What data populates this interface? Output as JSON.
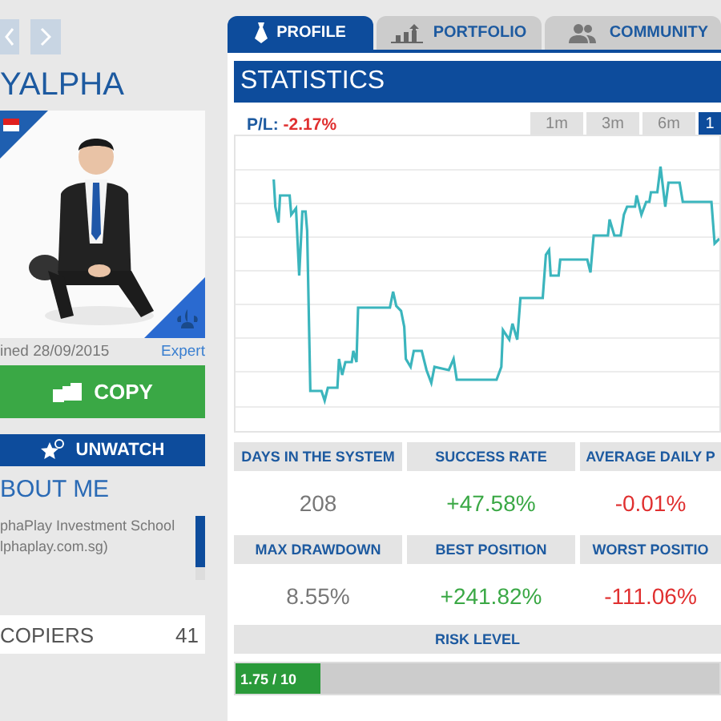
{
  "profile": {
    "name": "YALPHA",
    "joined": "ined 28/09/2015",
    "rank": "Expert",
    "copy_button": "COPY",
    "watch_button": "UNWATCH",
    "about_title": "BOUT ME",
    "about_lines": [
      "phaPlay Investment School",
      "lphaplay.com.sg)"
    ],
    "copiers_label": "COPIERS",
    "copiers_count": "41"
  },
  "tabs": [
    {
      "label": "PROFILE",
      "kind": "tie",
      "selected": true
    },
    {
      "label": "PORTFOLIO",
      "kind": "bars",
      "selected": false
    },
    {
      "label": "COMMUNITY",
      "kind": "people",
      "selected": false
    }
  ],
  "statistics": {
    "title": "STATISTICS",
    "pl_label": "P/L:",
    "pl_value": "-2.17%",
    "ranges": [
      {
        "label": "1m",
        "selected": false
      },
      {
        "label": "3m",
        "selected": false
      },
      {
        "label": "6m",
        "selected": false
      },
      {
        "label": "1",
        "selected": true
      }
    ],
    "stats": [
      {
        "label": "DAYS IN THE SYSTEM",
        "value": "208",
        "kind": "neutral"
      },
      {
        "label": "SUCCESS RATE",
        "value": "+47.58%",
        "kind": "positive"
      },
      {
        "label": "AVERAGE DAILY P",
        "value": "-0.01%",
        "kind": "negative"
      },
      {
        "label": "MAX DRAWDOWN",
        "value": "8.55%",
        "kind": "neutral"
      },
      {
        "label": "BEST POSITION",
        "value": "+241.82%",
        "kind": "positive"
      },
      {
        "label": "WORST POSITIO",
        "value": "-111.06%",
        "kind": "negative"
      }
    ],
    "risk": {
      "label": "RISK LEVEL",
      "reading": "1.75 / 10",
      "level": 0.175
    }
  }
}
